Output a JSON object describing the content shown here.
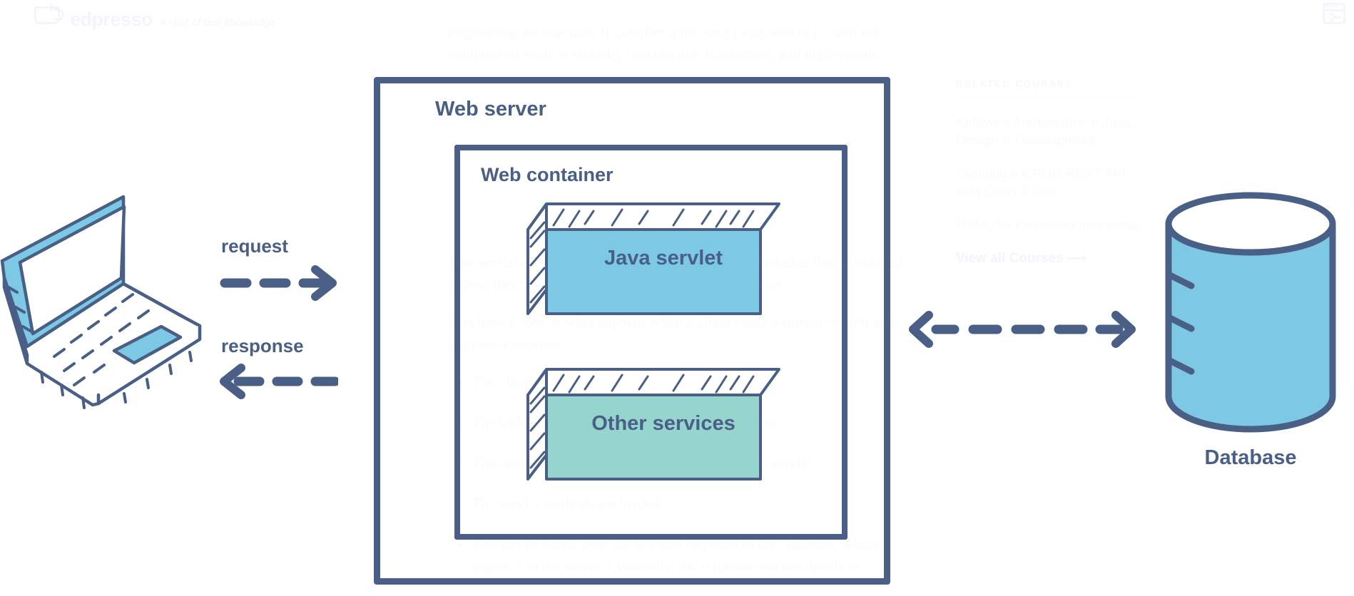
{
  "colors": {
    "ink": "#4a5f85",
    "servlet_fill": "#7dc8e4",
    "services_fill": "#95d5cd",
    "db_fill": "#7dc8e4",
    "page_bg": "#ffffff",
    "faint_text": "#fafbfe"
  },
  "brand": {
    "name": "edpresso",
    "tagline": "a shot of dev knowledge",
    "logo_icon": "coffee-cup-icon",
    "corner_icon": "code-window-icon"
  },
  "article": {
    "paragraphs": [
      "engineering architecture; it specifies a run time environment for various components such as security, concurrency, transaction, and deployment.",
      "Java servlets need a supporting environment, i.e. a container that is required to load them. The servlet gets deployed on the container.",
      "Lets have a look at what happens when a client sends a certain request and requires a response:"
    ],
    "bullets": [
      "The client sends a request.",
      "The web server passes that request to the container.",
      "The container passes the request to the respective servlet.",
      "The servlet methods are loaded.",
      "The servlet hands over the relevant response to the container, which passes it to the server. Eventually, the response reaches the client."
    ]
  },
  "sidebar": {
    "title": "RELATED COURSES",
    "courses": [
      "Software Architecture in Java: Design & Development",
      "Creating a CRUD REST API with Deno & Oak",
      "HTML for Front-end Interviews"
    ],
    "view_all": "View all Courses  ⟶"
  },
  "diagram": {
    "client_icon": "laptop-icon",
    "request_label": "request",
    "response_label": "response",
    "web_server_label": "Web server",
    "web_container_label": "Web container",
    "servlet_label": "Java servlet",
    "services_label": "Other services",
    "database_label": "Database",
    "database_icon": "database-cylinder-icon",
    "request_arrow": "arrow-right-dashed",
    "response_arrow": "arrow-left-dashed",
    "db_arrow": "arrow-bidirectional-dashed"
  }
}
